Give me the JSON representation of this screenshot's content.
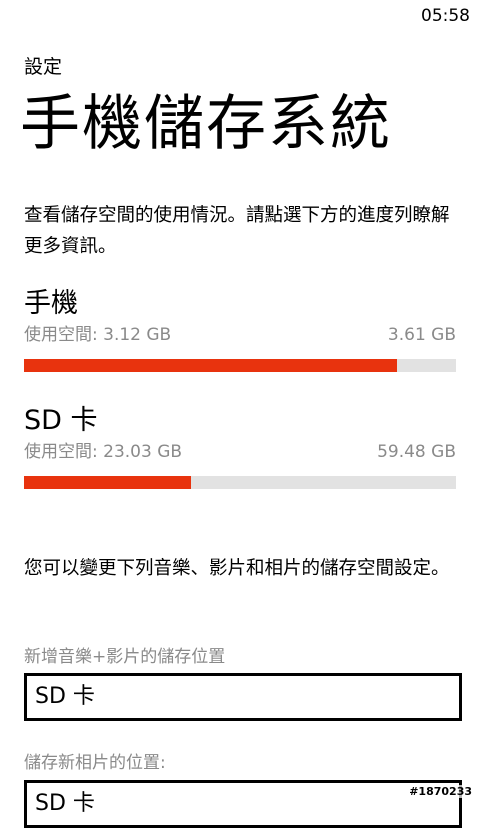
{
  "status_bar": {
    "time": "05:58"
  },
  "header": {
    "app_title": "設定",
    "page_title": "手機儲存系統"
  },
  "intro_text": "查看儲存空間的使用情況。請點選下方的進度列瞭解更多資訊。",
  "storage": [
    {
      "name": "手機",
      "used_label": "使用空間: 3.12 GB",
      "total": "3.61 GB",
      "used_fraction": 0.864
    },
    {
      "name": "SD 卡",
      "used_label": "使用空間: 23.03 GB",
      "total": "59.48 GB",
      "used_fraction": 0.387
    }
  ],
  "change_text": "您可以變更下列音樂、影片和相片的儲存空間設定。",
  "settings": {
    "music_label": "新增音樂+影片的儲存位置",
    "music_value": "SD 卡",
    "photo_label": "儲存新相片的位置:",
    "photo_value": "SD 卡"
  },
  "watermark": "#1870233",
  "colors": {
    "accent": "#e8330e",
    "bar_bg": "#e2e2e2",
    "muted_text": "#8a8a8a"
  }
}
